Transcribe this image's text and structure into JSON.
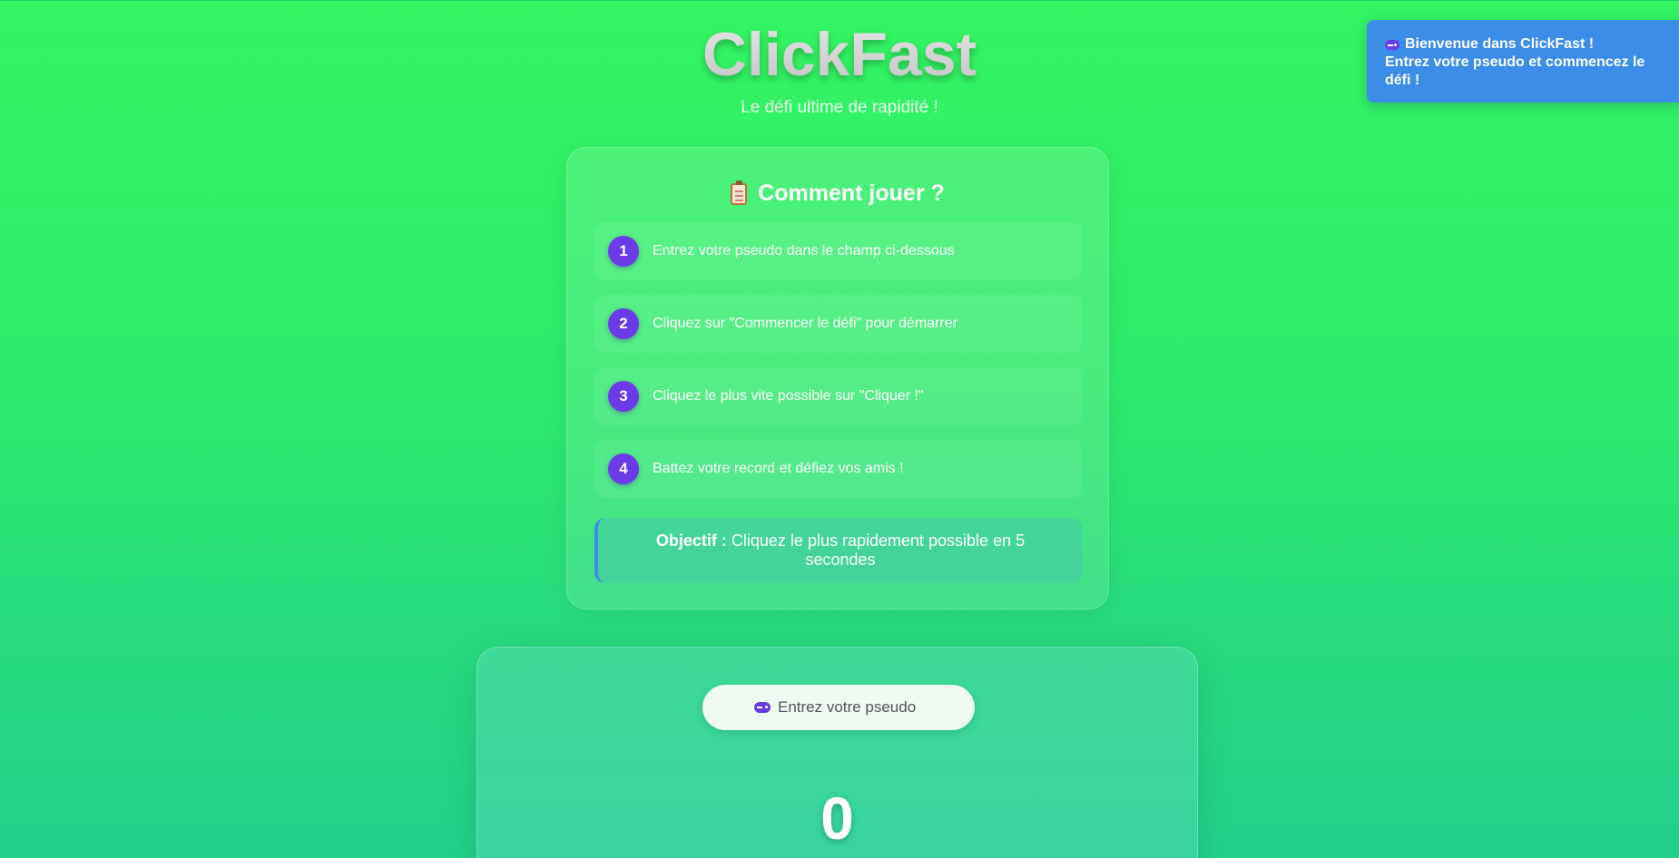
{
  "app": {
    "title": "ClickFast",
    "subtitle": "Le défi ultime de rapidité !"
  },
  "howto": {
    "icon": "clipboard-icon",
    "title": "Comment jouer ?",
    "steps": [
      {
        "num": "1",
        "text": "Entrez votre pseudo dans le champ ci-dessous"
      },
      {
        "num": "2",
        "text": "Cliquez sur \"Commencer le défi\" pour démarrer"
      },
      {
        "num": "3",
        "text": "Cliquez le plus vite possible sur \"Cliquer !\""
      },
      {
        "num": "4",
        "text": "Battez votre record et défiez vos amis !"
      }
    ],
    "objective": {
      "label": "Objectif :",
      "text": " Cliquez le plus rapidement possible en 5 secondes"
    }
  },
  "game": {
    "pseudo_placeholder": "Entrez votre pseudo",
    "pseudo_icon": "gamepad-icon",
    "score": "0"
  },
  "toast": {
    "icon": "gamepad-icon",
    "line1": "Bienvenue dans ClickFast !",
    "line2": "Entrez votre pseudo et commencez le défi !"
  },
  "colors": {
    "background_top": "#33f562",
    "background_bottom": "#22d18c",
    "step_badge": "#6a3be6",
    "toast": "#3b8de8",
    "objective_border": "#3a8fe6"
  }
}
